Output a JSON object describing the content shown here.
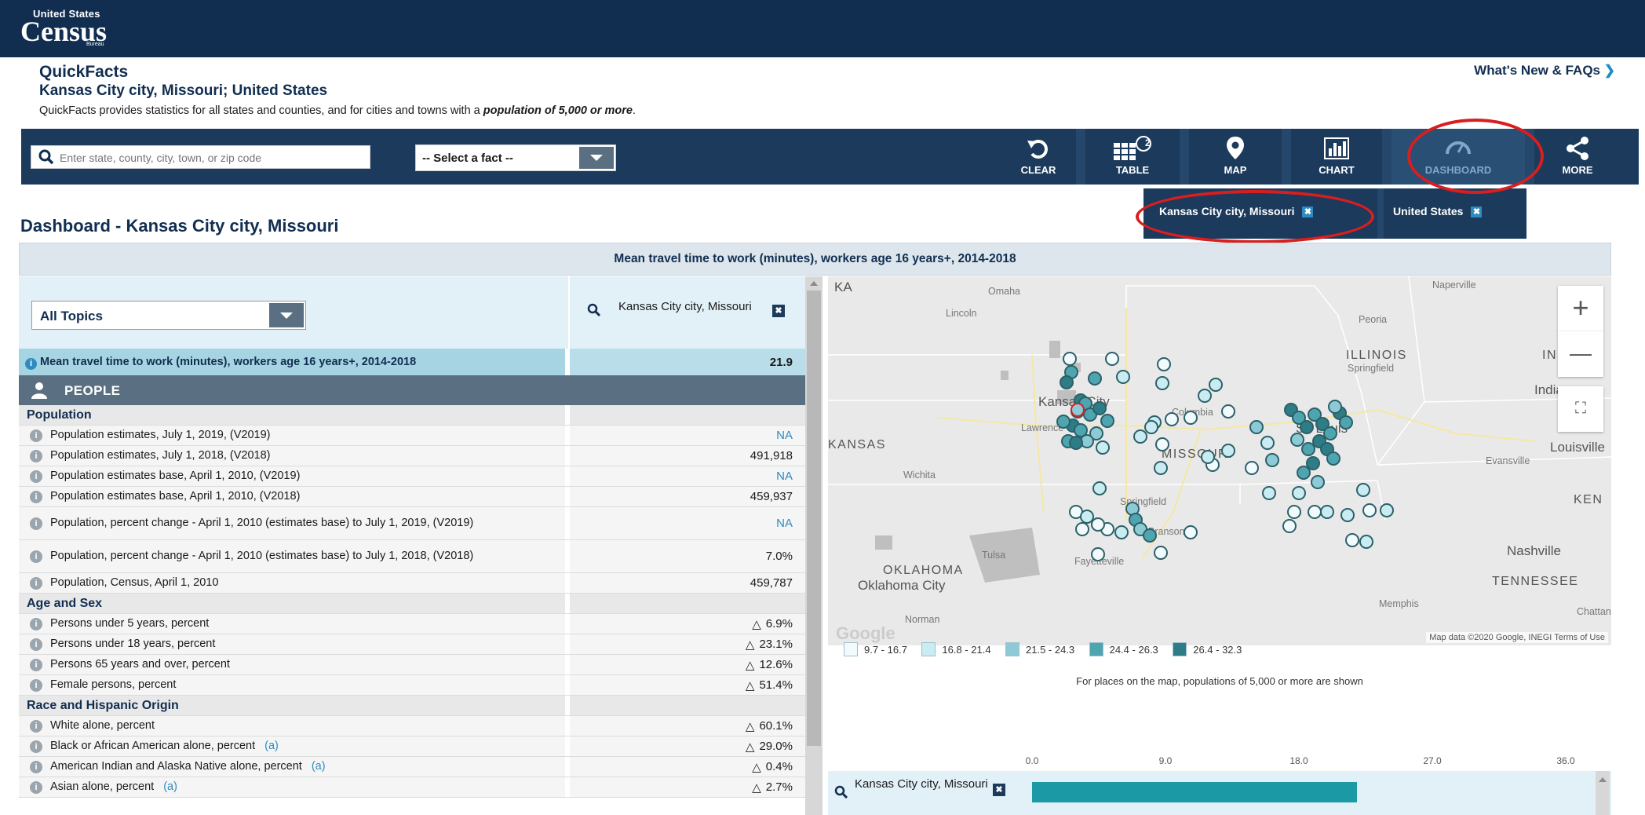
{
  "brand": {
    "small": "United States",
    "name": "Census",
    "bureau": "Bureau"
  },
  "header": {
    "title": "QuickFacts",
    "subtitle": "Kansas City city, Missouri; United States",
    "description_pre": "QuickFacts provides statistics for all states and counties, and for cities and towns with a",
    "description_em": "population of 5,000 or more",
    "description_post": ".",
    "whats_new": "What's New & FAQs",
    "whats_new_icon": "chevron-right-icon"
  },
  "toolbar": {
    "search_placeholder": "Enter state, county, city, town, or zip code",
    "fact_select": "-- Select a fact --",
    "buttons": [
      {
        "label": "CLEAR",
        "icon": "clear-icon"
      },
      {
        "label": "TABLE",
        "icon": "table-icon",
        "badge": "2"
      },
      {
        "label": "MAP",
        "icon": "map-pin-icon"
      },
      {
        "label": "CHART",
        "icon": "chart-icon"
      },
      {
        "label": "DASHBOARD",
        "icon": "dashboard-icon",
        "active": true
      },
      {
        "label": "MORE",
        "icon": "share-icon"
      }
    ]
  },
  "geo_tabs": [
    {
      "label": "Kansas City city, Missouri",
      "close": "✖"
    },
    {
      "label": "United States",
      "close": "✖"
    }
  ],
  "dashboard": {
    "title": "Dashboard - Kansas City city, Missouri",
    "banner": "Mean travel time to work (minutes), workers age 16 years+, 2014-2018"
  },
  "table": {
    "topics_select": "All Topics",
    "geo_column": "Kansas City city, Missouri",
    "geo_close": "✖",
    "highlight_row": {
      "label": "Mean travel time to work (minutes), workers age 16 years+, 2014-2018",
      "value": "21.9"
    },
    "people_section": "PEOPLE",
    "rows": [
      {
        "type": "section",
        "label": "Population"
      },
      {
        "type": "row",
        "label": "Population estimates, July 1, 2019, (V2019)",
        "value": "NA",
        "na": true
      },
      {
        "type": "row",
        "label": "Population estimates, July 1, 2018, (V2018)",
        "value": "491,918"
      },
      {
        "type": "row",
        "label": "Population estimates base, April 1, 2010, (V2019)",
        "value": "NA",
        "na": true
      },
      {
        "type": "row",
        "label": "Population estimates base, April 1, 2010, (V2018)",
        "value": "459,937"
      },
      {
        "type": "row",
        "tall": true,
        "label": "Population, percent change - April 1, 2010 (estimates base) to July 1, 2019, (V2019)",
        "value": "NA",
        "na": true
      },
      {
        "type": "row",
        "tall": true,
        "label": "Population, percent change - April 1, 2010 (estimates base) to July 1, 2018, (V2018)",
        "value": "7.0%"
      },
      {
        "type": "row",
        "label": "Population, Census, April 1, 2010",
        "value": "459,787"
      },
      {
        "type": "section",
        "label": "Age and Sex"
      },
      {
        "type": "row",
        "label": "Persons under 5 years, percent",
        "value": "6.9%",
        "flag": true
      },
      {
        "type": "row",
        "label": "Persons under 18 years, percent",
        "value": "23.1%",
        "flag": true
      },
      {
        "type": "row",
        "label": "Persons 65 years and over, percent",
        "value": "12.6%",
        "flag": true
      },
      {
        "type": "row",
        "label": "Female persons, percent",
        "value": "51.4%",
        "flag": true
      },
      {
        "type": "section",
        "label": "Race and Hispanic Origin"
      },
      {
        "type": "row",
        "label": "White alone, percent",
        "value": "60.1%",
        "flag": true
      },
      {
        "type": "row",
        "label": "Black or African American alone, percent",
        "footnote": "(a)",
        "value": "29.0%",
        "flag": true
      },
      {
        "type": "row",
        "label": "American Indian and Alaska Native alone, percent",
        "footnote": "(a)",
        "value": "0.4%",
        "flag": true
      },
      {
        "type": "row",
        "label": "Asian alone, percent",
        "footnote": "(a)",
        "value": "2.7%",
        "flag": true
      }
    ]
  },
  "map": {
    "labels": {
      "ks_abbrev": "KA",
      "omaha": "Omaha",
      "lincoln": "Lincoln",
      "naperville": "Naperville",
      "peoria": "Peoria",
      "illinois": "ILLINOIS",
      "springfield_il": "Springfield",
      "indiana_abbr": "IND",
      "indiana": "Indiana",
      "kansas_city": "Kansas City",
      "lawrence": "Lawrence",
      "columbia": "Columbia",
      "st_louis": "St. Louis",
      "kansas": "KANSAS",
      "missouri": "MISSOURI",
      "louisville": "Louisville",
      "evansville": "Evansville",
      "wichita": "Wichita",
      "ken": "KEN",
      "springfield_mo": "Springfield",
      "branson": "Branson",
      "tulsa": "Tulsa",
      "fayetteville": "Fayetteville",
      "nashville": "Nashville",
      "oklahoma": "OKLAHOMA",
      "oklahoma_city": "Oklahoma City",
      "tennessee": "TENNESSEE",
      "memphis": "Memphis",
      "chattanooga": "Chattan",
      "norman": "Norman"
    },
    "zoom_in": "+",
    "zoom_out": "—",
    "google": "Google",
    "attribution": "Map data ©2020 Google, INEGI   Terms of Use",
    "legend": [
      {
        "range": "9.7 - 16.7",
        "color": "#f1fafc"
      },
      {
        "range": "16.8 - 21.4",
        "color": "#c9ecf2"
      },
      {
        "range": "21.5 - 24.3",
        "color": "#8ccbd6"
      },
      {
        "range": "24.4 - 26.3",
        "color": "#4ea5b0"
      },
      {
        "range": "26.4 - 32.3",
        "color": "#2e7d86"
      }
    ],
    "note": "For places on the map, populations of 5,000 or more are shown"
  },
  "chart_data": {
    "type": "bar",
    "x_ticks": [
      "0.0",
      "9.0",
      "18.0",
      "27.0",
      "36.0"
    ],
    "xlim": [
      0,
      36
    ],
    "categories": [
      "Kansas City city, Missouri"
    ],
    "values": [
      21.9
    ],
    "color": "#1b9aa5"
  },
  "colors": {
    "navy": "#112e51",
    "toolbar": "#1b3a5c",
    "accent": "#2f8bbf",
    "annotation": "#d81e1e"
  }
}
